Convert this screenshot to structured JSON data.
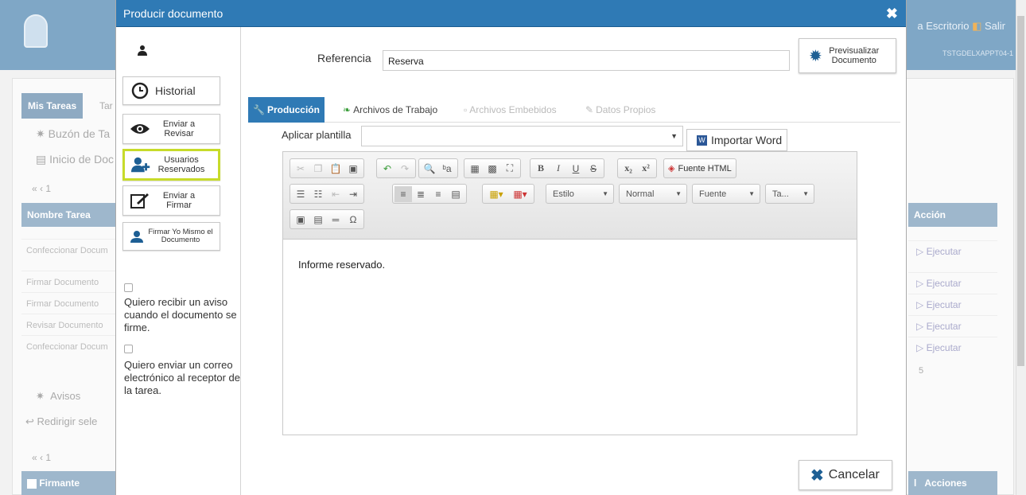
{
  "background": {
    "top_links": "a Escritorio",
    "salir": "Salir",
    "server": "TSTGDELXAPPT04-1",
    "tab_mis_tareas": "Mis Tareas",
    "tab_tar": "Tar",
    "buzon": "Buzón de Ta",
    "inicio": "Inicio de Doc",
    "pager": "« ‹ 1",
    "col_nombre": "Nombre Tarea",
    "col_accion": "Acción",
    "rows": [
      "Confeccionar Docum",
      "Firmar Documento",
      "Firmar Documento",
      "Revisar Documento",
      "Confeccionar Docum"
    ],
    "exec_label": "▷ Ejecutar",
    "count": "5",
    "avisos": "Avisos",
    "redirigir": "Redirigir sele",
    "pager2": "« ‹ 1",
    "col_firmante": "Firmante",
    "col_acciones": "Acciones",
    "col_l": "l"
  },
  "modal": {
    "title": "Producir documento",
    "close_icon": "close-icon",
    "sidebar": {
      "buttons": {
        "historial": "Historial",
        "enviar_revisar": "Enviar a Revisar",
        "usuarios_reservados": "Usuarios Reservados",
        "enviar_firmar": "Enviar a Firmar",
        "firmar_yo_mismo": "Firmar Yo Mismo el Documento"
      },
      "checkbox1": "Quiero recibir un aviso cuando el documento se firme.",
      "checkbox2": "Quiero enviar un correo electrónico al receptor de la tarea."
    },
    "referencia_label": "Referencia",
    "referencia_value": "Reserva",
    "preview_button": "Previsualizar Documento",
    "tabs": [
      "Producción",
      "Archivos de Trabajo",
      "Archivos Embebidos",
      "Datos Propios"
    ],
    "plantilla_label": "Aplicar plantilla",
    "plantilla_value": "",
    "importar_word": "Importar Word",
    "toolbar": {
      "fuente_html": "Fuente HTML",
      "estilo": "Estilo",
      "normal": "Normal",
      "fuente": "Fuente",
      "tamano": "Ta..."
    },
    "editor_text": "Informe reservado.",
    "cancel_button": "Cancelar"
  },
  "colors": {
    "header_blue": "#2f7ab5",
    "highlight": "#c7db2a"
  }
}
